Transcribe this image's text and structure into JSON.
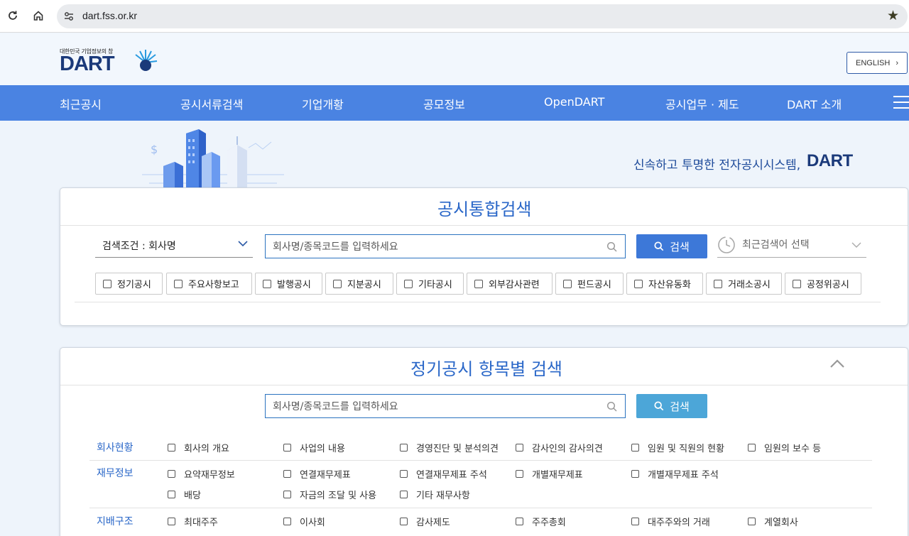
{
  "browser": {
    "url": "dart.fss.or.kr"
  },
  "header": {
    "logo_tagline": "대한민국 기업정보의 창",
    "logo_text": "DART",
    "lang_button": "ENGLISH"
  },
  "nav": {
    "items": [
      "최근공시",
      "공시서류검색",
      "기업개황",
      "공모정보",
      "OpenDART",
      "공시업무 · 제도",
      "DART 소개"
    ]
  },
  "hero": {
    "slogan": "신속하고 투명한 전자공시시스템,",
    "slogan_logo": "DART"
  },
  "integrated_search": {
    "title": "공시통합검색",
    "condition_label": "검색조건 : 회사명",
    "input_placeholder": "회사명/종목코드를 입력하세요",
    "search_button": "검색",
    "recent_label": "최근검색어 선택",
    "types": [
      "정기공시",
      "주요사항보고",
      "발행공시",
      "지분공시",
      "기타공시",
      "외부감사관련",
      "펀드공시",
      "자산유동화",
      "거래소공시",
      "공정위공시"
    ]
  },
  "periodic_search": {
    "title": "정기공시 항목별 검색",
    "input_placeholder": "회사명/종목코드를 입력하세요",
    "search_button": "검색",
    "categories": [
      {
        "label": "회사현황",
        "options": [
          "회사의 개요",
          "사업의 내용",
          "경영진단 및 분석의견",
          "감사인의 감사의견",
          "임원 및 직원의 현황",
          "임원의 보수 등"
        ]
      },
      {
        "label": "재무정보",
        "options": [
          "요약재무정보",
          "연결재무제표",
          "연결재무제표 주석",
          "개별재무제표",
          "개별재무제표 주석",
          "배당",
          "자금의 조달 및 사용",
          "기타 재무사항"
        ]
      },
      {
        "label": "지배구조",
        "options": [
          "최대주주",
          "이사회",
          "감사제도",
          "주주총회",
          "대주주와의 거래",
          "계열회사"
        ]
      }
    ]
  },
  "colors": {
    "nav_bg": "#4a83e2",
    "brand_navy": "#1b3a7a",
    "title_blue": "#2a67c8",
    "search_btn": "#3d78d8",
    "search_btn_light": "#4ca6d8"
  }
}
